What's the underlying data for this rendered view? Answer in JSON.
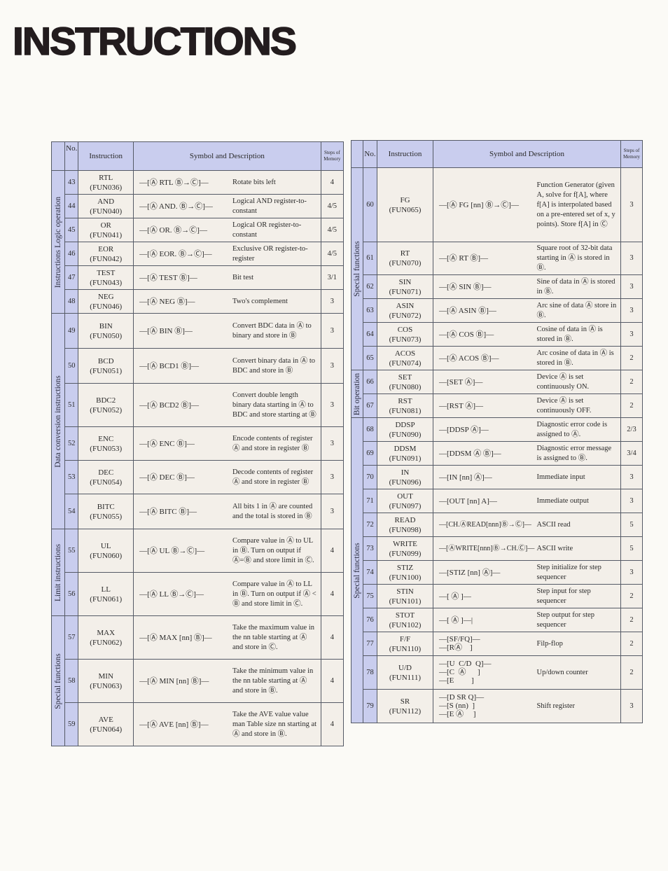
{
  "page": {
    "title": "INSTRUCTIONS"
  },
  "header": {
    "no": "No.",
    "instruction": "Instruction",
    "symbol_description": "Symbol and Description",
    "steps": "Steps of Memory"
  },
  "colors": {
    "header_bg": "#c9cdee",
    "cell_bg": "#f3efe9",
    "title": "#231c1e"
  },
  "left_table": {
    "groups": [
      {
        "label": "Instructions Logic operation",
        "rows": 6
      },
      {
        "label": "Data conversion instructions",
        "rows": 6
      },
      {
        "label": "Limit instructions",
        "rows": 2
      },
      {
        "label": "Special functions",
        "rows": 3
      }
    ],
    "rows": [
      {
        "no": "43",
        "name": "RTL",
        "fun": "(FUN036)",
        "symbol": "—[Ⓐ RTL Ⓑ→Ⓒ]—",
        "desc": "Rotate bits left",
        "steps": "4"
      },
      {
        "no": "44",
        "name": "AND",
        "fun": "(FUN040)",
        "symbol": "—[Ⓐ AND. Ⓑ→Ⓒ]—",
        "desc": "Logical AND register-to-constant",
        "steps": "4/5"
      },
      {
        "no": "45",
        "name": "OR",
        "fun": "(FUN041)",
        "symbol": "—[Ⓐ OR. Ⓑ→Ⓒ]—",
        "desc": "Logical OR register-to-constant",
        "steps": "4/5"
      },
      {
        "no": "46",
        "name": "EOR",
        "fun": "(FUN042)",
        "symbol": "—[Ⓐ EOR. Ⓑ→Ⓒ]—",
        "desc": "Exclusive OR register-to-register",
        "steps": "4/5"
      },
      {
        "no": "47",
        "name": "TEST",
        "fun": "(FUN043)",
        "symbol": "—[Ⓐ TEST Ⓑ]—",
        "desc": "Bit test",
        "steps": "3/1"
      },
      {
        "no": "48",
        "name": "NEG",
        "fun": "(FUN046)",
        "symbol": "—[Ⓐ NEG Ⓑ]—",
        "desc": "Two's complement",
        "steps": "3"
      },
      {
        "no": "49",
        "name": "BIN",
        "fun": "(FUN050)",
        "symbol": "—[Ⓐ BIN Ⓑ]—",
        "desc": "Convert BDC data in Ⓐ to binary and store in Ⓑ",
        "steps": "3"
      },
      {
        "no": "50",
        "name": "BCD",
        "fun": "(FUN051)",
        "symbol": "—[Ⓐ BCD1 Ⓑ]—",
        "desc": "Convert binary data in Ⓐ to BDC and store in Ⓑ",
        "steps": "3"
      },
      {
        "no": "51",
        "name": "BDC2",
        "fun": "(FUN052)",
        "symbol": "—[Ⓐ BCD2 Ⓑ]—",
        "desc": "Convert double length binary data starting in Ⓐ to BDC and store starting at Ⓑ",
        "steps": "3"
      },
      {
        "no": "52",
        "name": "ENC",
        "fun": "(FUN053)",
        "symbol": "—[Ⓐ ENC Ⓑ]—",
        "desc": "Encode contents of register Ⓐ and store in register Ⓑ",
        "steps": "3"
      },
      {
        "no": "53",
        "name": "DEC",
        "fun": "(FUN054)",
        "symbol": "—[Ⓐ DEC Ⓑ]—",
        "desc": "Decode contents of register Ⓐ and store in register Ⓑ",
        "steps": "3"
      },
      {
        "no": "54",
        "name": "BITC",
        "fun": "(FUN055)",
        "symbol": "—[Ⓐ BITC Ⓑ]—",
        "desc": "All bits 1 in Ⓐ are counted and the total is stored in Ⓑ",
        "steps": "3"
      },
      {
        "no": "55",
        "name": "UL",
        "fun": "(FUN060)",
        "symbol": "—[Ⓐ UL Ⓑ→Ⓒ]—",
        "desc": "Compare value in Ⓐ to UL in Ⓑ. Turn on output if Ⓐ=Ⓑ and store limit in Ⓒ.",
        "steps": "4"
      },
      {
        "no": "56",
        "name": "LL",
        "fun": "(FUN061)",
        "symbol": "—[Ⓐ LL Ⓑ→Ⓒ]—",
        "desc": "Compare value in Ⓐ to LL in Ⓑ. Turn on output if Ⓐ < Ⓑ and store limit in Ⓒ.",
        "steps": "4"
      },
      {
        "no": "57",
        "name": "MAX",
        "fun": "(FUN062)",
        "symbol": "—[Ⓐ MAX [nn] Ⓑ]—",
        "desc": "Take the maximum value in the nn table starting at Ⓐ and store in Ⓒ.",
        "steps": "4"
      },
      {
        "no": "58",
        "name": "MIN",
        "fun": "(FUN063)",
        "symbol": "—[Ⓐ MIN [nn] Ⓑ]—",
        "desc": "Take the minimum value in the nn table starting at Ⓐ and store in Ⓑ.",
        "steps": "4"
      },
      {
        "no": "59",
        "name": "AVE",
        "fun": "(FUN064)",
        "symbol": "—[Ⓐ AVE [nn] Ⓑ]—",
        "desc": "Take the AVE value value man Table size nn starting at Ⓐ and store in Ⓑ.",
        "steps": "4"
      }
    ]
  },
  "right_table": {
    "groups": [
      {
        "label": "Special functions",
        "rows": 6
      },
      {
        "label": "Bit operation",
        "rows": 2
      },
      {
        "label": "Special functions",
        "rows": 12
      }
    ],
    "rows": [
      {
        "no": "60",
        "name": "FG",
        "fun": "(FUN065)",
        "symbol": "—[Ⓐ FG [nn] Ⓑ→Ⓒ]—",
        "desc": "Function Generator (given A, solve for f[A], where f[A] is interpolated based on a pre-entered set of x, y points). Store f[A] in Ⓒ",
        "steps": "3"
      },
      {
        "no": "61",
        "name": "RT",
        "fun": "(FUN070)",
        "symbol": "—[Ⓐ RT Ⓑ]—",
        "desc": "Square root of 32-bit data starting in Ⓐ is stored in Ⓑ.",
        "steps": "3"
      },
      {
        "no": "62",
        "name": "SIN",
        "fun": "(FUN071)",
        "symbol": "—[Ⓐ SIN Ⓑ]—",
        "desc": "Sine of data in Ⓐ is stored in Ⓑ.",
        "steps": "3"
      },
      {
        "no": "63",
        "name": "ASIN",
        "fun": "(FUN072)",
        "symbol": "—[Ⓐ ASIN Ⓑ]—",
        "desc": "Arc sine of data Ⓐ store in Ⓑ.",
        "steps": "3"
      },
      {
        "no": "64",
        "name": "COS",
        "fun": "(FUN073)",
        "symbol": "—[Ⓐ COS Ⓑ]—",
        "desc": "Cosine of data in Ⓐ is stored in Ⓑ.",
        "steps": "3"
      },
      {
        "no": "65",
        "name": "ACOS",
        "fun": "(FUN074)",
        "symbol": "—[Ⓐ ACOS Ⓑ]—",
        "desc": "Arc cosine of data in Ⓐ is stored in Ⓑ.",
        "steps": "2"
      },
      {
        "no": "66",
        "name": "SET",
        "fun": "(FUN080)",
        "symbol": "—[SET Ⓐ]—",
        "desc": "Device Ⓐ is set continuously ON.",
        "steps": "2"
      },
      {
        "no": "67",
        "name": "RST",
        "fun": "(FUN081)",
        "symbol": "—[RST Ⓐ]—",
        "desc": "Device Ⓐ is set continuously OFF.",
        "steps": "2"
      },
      {
        "no": "68",
        "name": "DDSP",
        "fun": "(FUN090)",
        "symbol": "—[DDSP Ⓐ]—",
        "desc": "Diagnostic error code is assigned to Ⓐ.",
        "steps": "2/3"
      },
      {
        "no": "69",
        "name": "DDSM",
        "fun": "(FUN091)",
        "symbol": "—[DDSM Ⓐ Ⓑ]—",
        "desc": "Diagnostic error message is assigned to Ⓑ.",
        "steps": "3/4"
      },
      {
        "no": "70",
        "name": "IN",
        "fun": "(FUN096)",
        "symbol": "—[IN [nn] Ⓐ]—",
        "desc": "Immediate input",
        "steps": "3"
      },
      {
        "no": "71",
        "name": "OUT",
        "fun": "(FUN097)",
        "symbol": "—[OUT [nn] A]—",
        "desc": "Immediate output",
        "steps": "3"
      },
      {
        "no": "72",
        "name": "READ",
        "fun": "(FUN098)",
        "symbol": "—[CH.ⒶREAD[nnn]Ⓑ→Ⓒ]—",
        "desc": "ASCII read",
        "steps": "5"
      },
      {
        "no": "73",
        "name": "WRITE",
        "fun": "(FUN099)",
        "symbol": "—[ⒶWRITE[nnn]Ⓑ→CH.Ⓒ]—",
        "desc": "ASCII write",
        "steps": "5"
      },
      {
        "no": "74",
        "name": "STIZ",
        "fun": "(FUN100)",
        "symbol": "—[STIZ [nn] Ⓐ]—",
        "desc": "Step initialize for step sequencer",
        "steps": "3"
      },
      {
        "no": "75",
        "name": "STIN",
        "fun": "(FUN101)",
        "symbol": "—[ Ⓐ ]—",
        "desc": "Step input for step sequencer",
        "steps": "2"
      },
      {
        "no": "76",
        "name": "STOT",
        "fun": "(FUN102)",
        "symbol": "—[ Ⓐ ]—|",
        "desc": "Step output for step sequencer",
        "steps": "2"
      },
      {
        "no": "77",
        "name": "F/F",
        "fun": "(FUN110)",
        "symbol_lines": [
          "—[SF/FQ]—",
          "—[RⒶ    ]"
        ],
        "desc": "Filp-flop",
        "steps": "2"
      },
      {
        "no": "78",
        "name": "U/D",
        "fun": "(FUN111)",
        "symbol_lines": [
          "—[U  C/D  Q]—",
          "—[C  Ⓐ      ]",
          "—[E         ]"
        ],
        "desc": "Up/down counter",
        "steps": "2"
      },
      {
        "no": "79",
        "name": "SR",
        "fun": "(FUN112)",
        "symbol_lines": [
          "—[D SR Q]—",
          "—[S (nn)  ]",
          "—[E Ⓐ     ]"
        ],
        "desc": "Shift register",
        "steps": "3"
      }
    ]
  }
}
